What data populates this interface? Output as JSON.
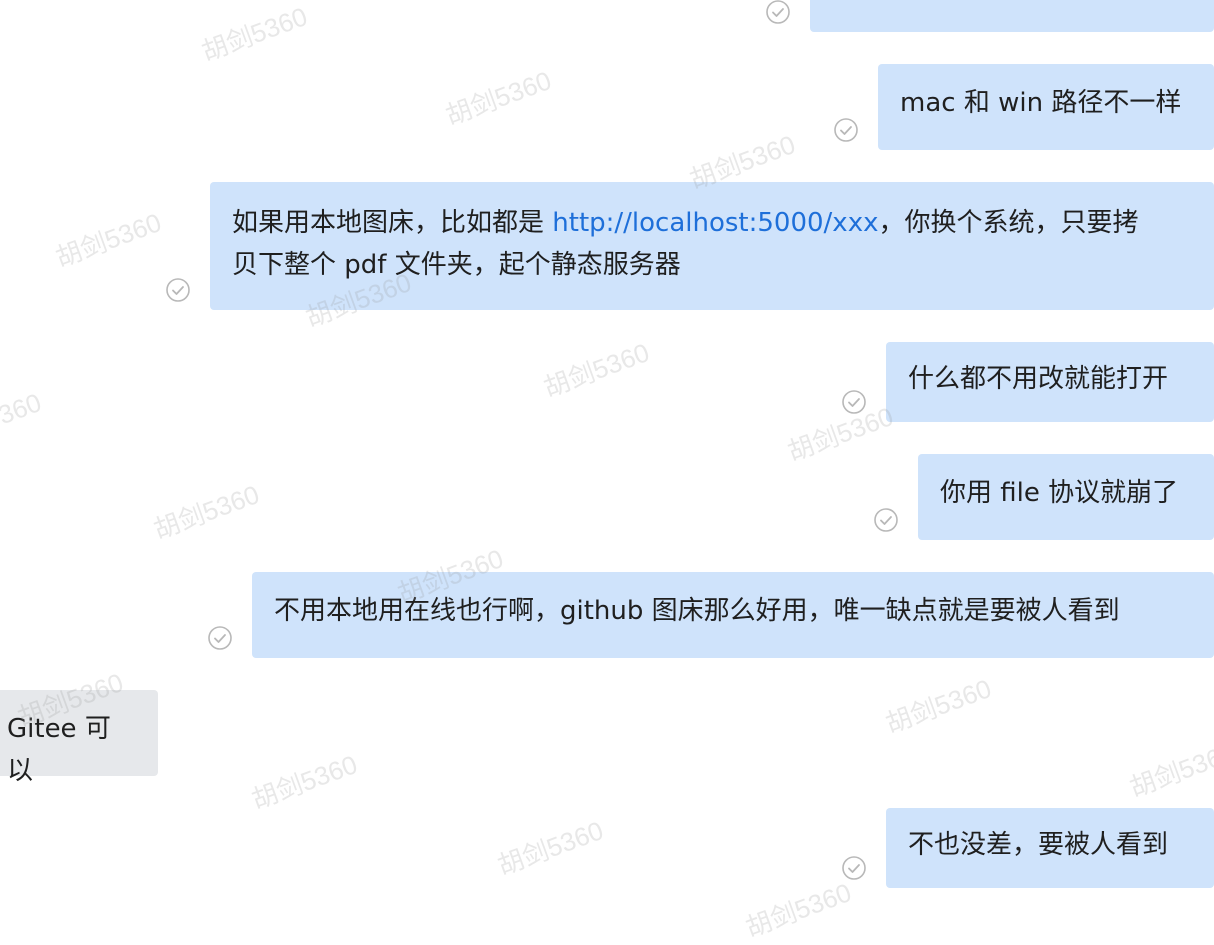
{
  "watermark_text": "胡剑5360",
  "watermarks": [
    {
      "text": "胡剑5360"
    },
    {
      "text": "胡剑5360"
    },
    {
      "text": "胡剑5360"
    },
    {
      "text": "胡剑5360"
    },
    {
      "text": "胡剑5360"
    },
    {
      "text": "胡剑5360"
    },
    {
      "text": "胡剑5360"
    },
    {
      "text": "胡剑5360"
    },
    {
      "text": "胡剑5360"
    },
    {
      "text": "胡剑5360"
    },
    {
      "text": "胡剑5360"
    },
    {
      "text": "胡剑5360"
    },
    {
      "text": "胡剑5360"
    },
    {
      "text": "胡剑5360"
    },
    {
      "text": "胡剑5360"
    },
    {
      "text": "胡剑5360"
    }
  ],
  "messages": [
    {
      "direction": "outgoing",
      "text_line1": "",
      "link": "",
      "text_line1b": "",
      "text_line2": "",
      "status": "read"
    },
    {
      "direction": "outgoing",
      "text": "mac 和 win 路径不一样",
      "status": "read"
    },
    {
      "direction": "outgoing",
      "text_before_link": "如果用本地图床，比如都是 ",
      "link": "http://localhost:5000/xxx",
      "text_after_link": "，你换个系统，只要拷",
      "text_line2": "贝下整个 pdf 文件夹，起个静态服务器",
      "status": "read"
    },
    {
      "direction": "outgoing",
      "text": "什么都不用改就能打开",
      "status": "read"
    },
    {
      "direction": "outgoing",
      "text": "你用 file 协议就崩了",
      "status": "read"
    },
    {
      "direction": "outgoing",
      "text": "不用本地用在线也行啊，github 图床那么好用，唯一缺点就是要被人看到",
      "status": "read"
    },
    {
      "direction": "incoming",
      "text": "Gitee 可以"
    },
    {
      "direction": "outgoing",
      "text": "不也没差，要被人看到",
      "status": "read"
    }
  ],
  "colors": {
    "outgoing_bubble": "#cfe3fb",
    "incoming_bubble": "#e6e8eb",
    "link": "#1e6fd9",
    "text": "#1f1f1f",
    "read_check": "#b8b8b8"
  },
  "icons": {
    "read_status": "check-circle-icon"
  }
}
